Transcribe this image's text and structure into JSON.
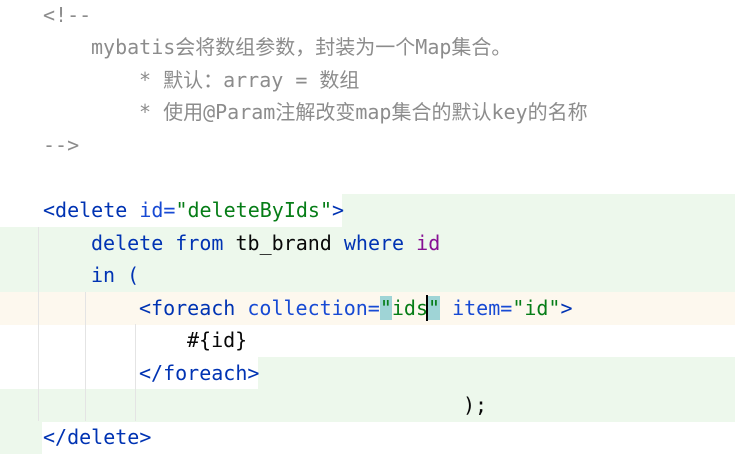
{
  "comment": {
    "open": "<!--",
    "line1": "mybatis会将数组参数，封装为一个Map集合。",
    "line2": "* 默认：array = 数组",
    "line3": "* 使用@Param注解改变map集合的默认key的名称",
    "close": "-->"
  },
  "code": {
    "delete_open_tag": "<delete",
    "id_attr": "id=",
    "id_value": "\"deleteByIds\"",
    "tag_close": ">",
    "sql_delete": "delete",
    "sql_from": "from",
    "sql_table": "tb_brand",
    "sql_where": "where",
    "sql_id": "id",
    "sql_in": "in (",
    "foreach_open": "<foreach",
    "collection_attr": "collection=",
    "quote_open": "\"",
    "collection_value": "ids",
    "quote_close": "\"",
    "item_attr": "item=",
    "item_value": "\"id\"",
    "foreach_tag_close": ">",
    "placeholder": "#{id}",
    "foreach_close": "</foreach>",
    "paren_close": ");",
    "delete_close": "</delete>"
  }
}
